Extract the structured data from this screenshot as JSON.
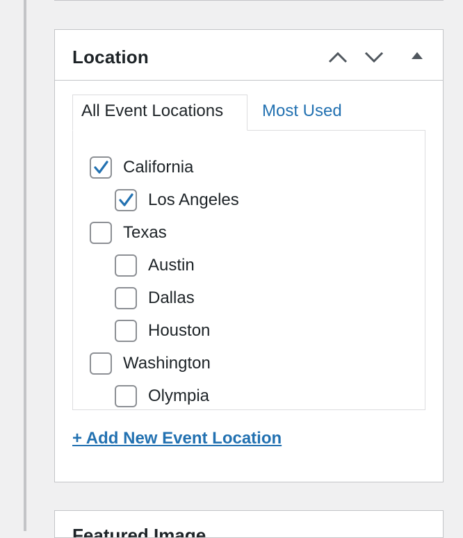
{
  "location_box": {
    "title": "Location",
    "tabs": [
      {
        "label": "All Event Locations",
        "active": true
      },
      {
        "label": "Most Used",
        "active": false
      }
    ],
    "items": [
      {
        "label": "California",
        "checked": true,
        "level": 0
      },
      {
        "label": "Los Angeles",
        "checked": true,
        "level": 1
      },
      {
        "label": "Texas",
        "checked": false,
        "level": 0
      },
      {
        "label": "Austin",
        "checked": false,
        "level": 1
      },
      {
        "label": "Dallas",
        "checked": false,
        "level": 1
      },
      {
        "label": "Houston",
        "checked": false,
        "level": 1
      },
      {
        "label": "Washington",
        "checked": false,
        "level": 0
      },
      {
        "label": "Olympia",
        "checked": false,
        "level": 1
      }
    ],
    "add_link": "+ Add New Event Location"
  },
  "next_box": {
    "title": "Featured Image"
  },
  "colors": {
    "link": "#2271b1",
    "check": "#2271b1",
    "border": "#c3c4c7",
    "background": "#f0f0f1"
  }
}
